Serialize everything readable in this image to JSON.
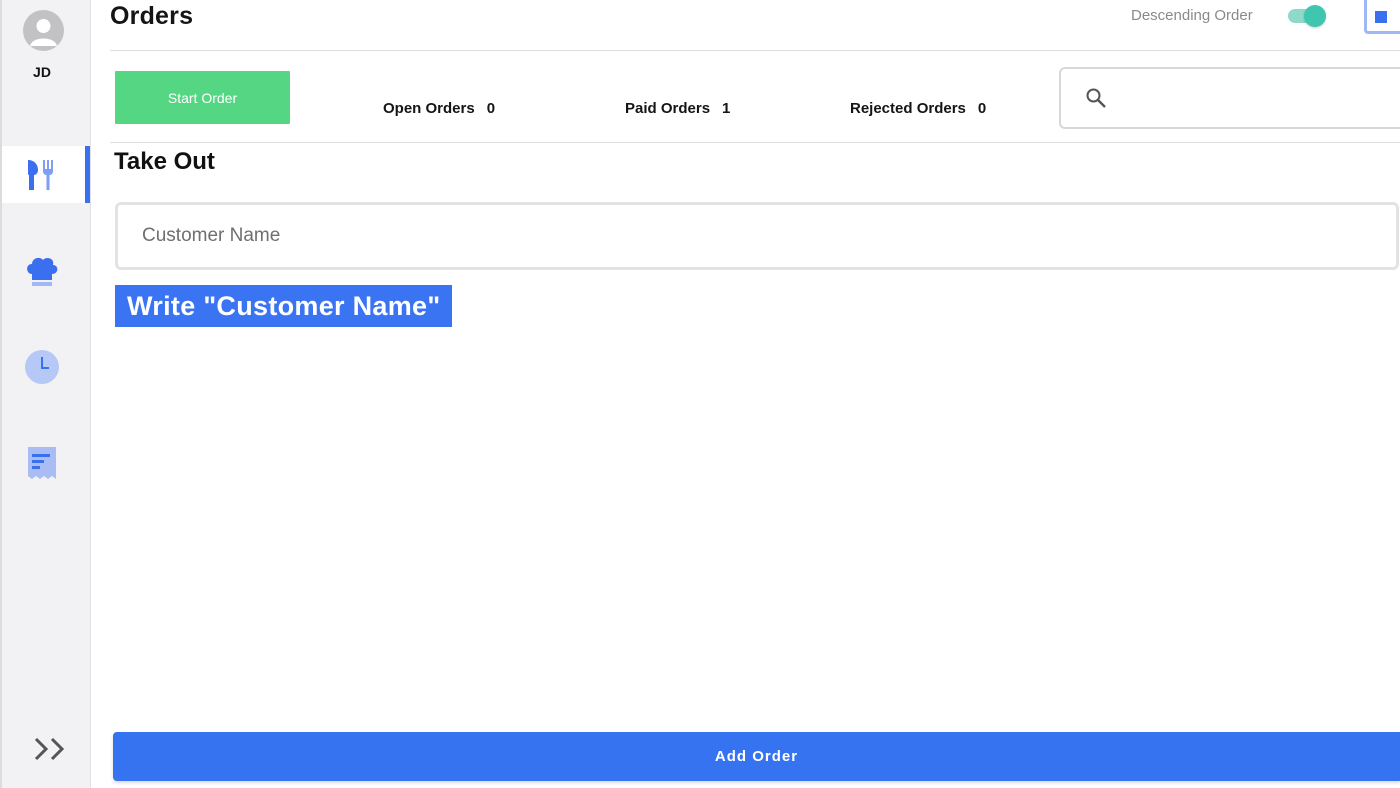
{
  "user": {
    "initials": "JD",
    "avatar_icon": "person-icon"
  },
  "sidebar": {
    "items": [
      {
        "id": "orders",
        "icon": "utensils-icon",
        "active": true
      },
      {
        "id": "kitchen",
        "icon": "chef-hat-icon",
        "active": false
      },
      {
        "id": "history",
        "icon": "clock-icon",
        "active": false
      },
      {
        "id": "receipts",
        "icon": "receipt-icon",
        "active": false
      }
    ],
    "expand_icon": "double-chevron-right-icon"
  },
  "header": {
    "title": "Orders",
    "sort_label": "Descending Order",
    "sort_toggle_on": true
  },
  "toolbar": {
    "start_order_label": "Start Order",
    "stats": [
      {
        "label": "Open Orders",
        "count": "0"
      },
      {
        "label": "Paid Orders",
        "count": "1"
      },
      {
        "label": "Rejected Orders",
        "count": "0"
      }
    ],
    "search_placeholder": ""
  },
  "takeout": {
    "title": "Take Out",
    "customer_name_placeholder": "Customer Name",
    "customer_name_value": ""
  },
  "instruction_text": "Write \"Customer Name\"",
  "footer": {
    "add_order_label": "Add Order"
  },
  "colors": {
    "accent": "#3a6ff0",
    "start_button": "#55d682",
    "toggle": "#3ec6ae",
    "instruction_bg": "#3a74f2"
  }
}
